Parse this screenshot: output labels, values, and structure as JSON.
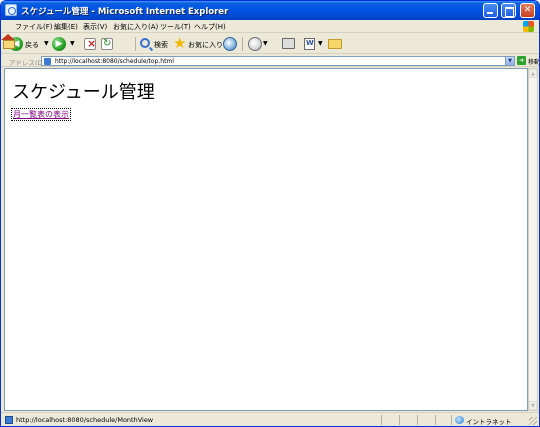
{
  "window": {
    "title": "スケジュール管理 - Microsoft Internet Explorer"
  },
  "menu": {
    "items": [
      "ファイル(F)",
      "編集(E)",
      "表示(V)",
      "お気に入り(A)",
      "ツール(T)",
      "ヘルプ(H)"
    ]
  },
  "toolbar": {
    "back_label": "戻る",
    "search_label": "検索",
    "favorites_label": "お気に入り"
  },
  "address": {
    "label": "アドレス(D)",
    "url": "http://localhost:8080/schedule/top.html",
    "go_label": "移動"
  },
  "page": {
    "title": "スケジュール管理",
    "link_text": "月一覧表の表示"
  },
  "status": {
    "text": "http://localhost:8080/schedule/MonthView",
    "zone": "イントラネット"
  },
  "colors": {
    "titlebar": "#0055e5",
    "visited_link": "#800080"
  }
}
